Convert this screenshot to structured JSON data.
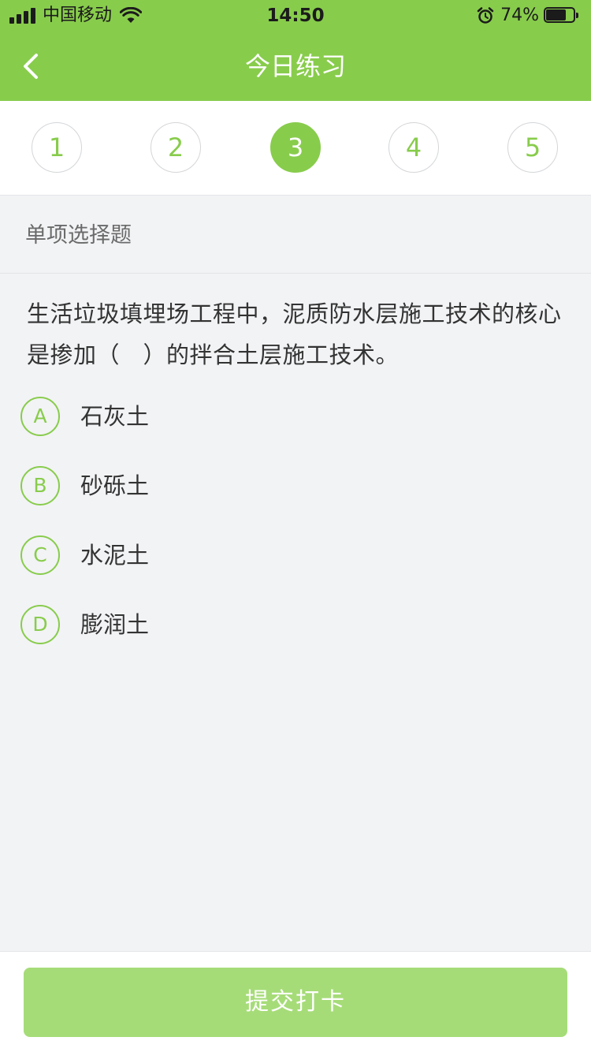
{
  "status_bar": {
    "carrier": "中国移动",
    "time": "14:50",
    "battery_percent_label": "74%",
    "battery_level": 0.74,
    "icons": [
      "signal-icon",
      "wifi-icon",
      "alarm-icon",
      "battery-icon"
    ]
  },
  "nav": {
    "title": "今日练习",
    "back_icon": "chevron-left-icon"
  },
  "question_numbers": {
    "items": [
      "1",
      "2",
      "3",
      "4",
      "5"
    ],
    "active": "3"
  },
  "question": {
    "type_label": "单项选择题",
    "text": "生活垃圾填埋场工程中，泥质防水层施工技术的核心是掺加（　）的拌合土层施工技术。",
    "options": [
      {
        "letter": "A",
        "text": "石灰土"
      },
      {
        "letter": "B",
        "text": "砂砾土"
      },
      {
        "letter": "C",
        "text": "水泥土"
      },
      {
        "letter": "D",
        "text": "膨润土"
      }
    ]
  },
  "footer": {
    "submit_label": "提交打卡"
  },
  "colors": {
    "brand_green": "#88cc4c",
    "submit_green": "#a6dc78",
    "background": "#f2f3f5"
  }
}
